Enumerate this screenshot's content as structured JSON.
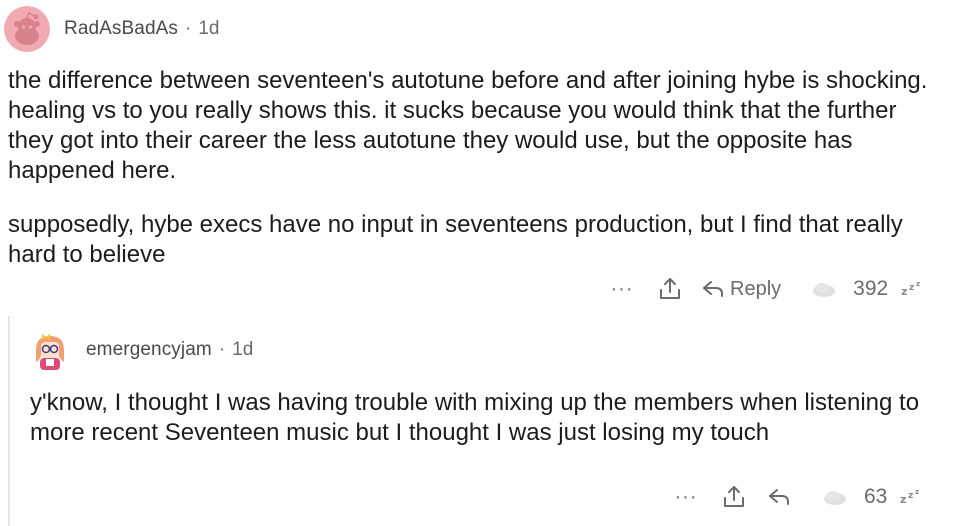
{
  "parent_comment": {
    "username": "RadAsBadAs",
    "separator": "·",
    "timestamp": "1d",
    "paragraphs": [
      "the difference between seventeen's autotune before and after joining hybe is shocking. healing vs to you really shows this. it sucks because you would think that the further they got into their career the less autotune they would use, but the opposite has happened here.",
      "supposedly, hybe execs have no input in seventeens production, but I find that really hard to believe"
    ],
    "more_label": "···",
    "reply_label": "Reply",
    "vote_count": "392",
    "avatar_color": "#f2aab2"
  },
  "child_comment": {
    "username": "emergencyjam",
    "separator": "·",
    "timestamp": "1d",
    "text": "y'know, I thought I was having trouble with mixing up the members when listening to more recent Seventeen music but I thought I was just losing my touch",
    "more_label": "···",
    "vote_count": "63"
  },
  "icons": {
    "share": "share-icon",
    "reply": "reply-arrow-icon",
    "award": "award-icon",
    "sleep": "zzz-icon"
  }
}
